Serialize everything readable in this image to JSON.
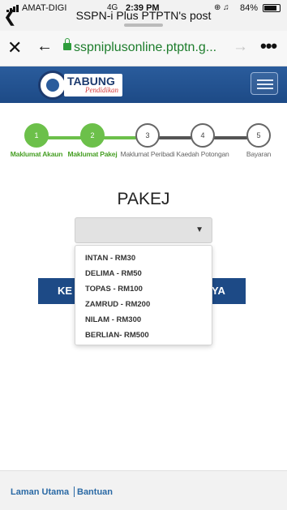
{
  "status_bar": {
    "carrier": "AMAT-DIGI",
    "network": "4G",
    "time": "2:39 PM",
    "battery": "84%"
  },
  "app_header": {
    "back_icon": "chevron-left-icon",
    "title": "SSPN-i Plus PTPTN's post"
  },
  "browser": {
    "url": "sspniplusonline.ptptn.g...",
    "secure_color": "#2e9d3c"
  },
  "site": {
    "logo_title": "TABUNG",
    "logo_subtitle": "Pendidikan",
    "banner_color": "#1d4a86"
  },
  "steps": [
    {
      "number": "1",
      "label": "Maklumat Akaun",
      "state": "done"
    },
    {
      "number": "2",
      "label": "Maklumat Pakej",
      "state": "done"
    },
    {
      "number": "3",
      "label": "Maklumat Peribadi",
      "state": "todo"
    },
    {
      "number": "4",
      "label": "Kaedah Potongan",
      "state": "todo"
    },
    {
      "number": "5",
      "label": "Bayaran",
      "state": "todo"
    }
  ],
  "page": {
    "heading": "PAKEJ",
    "select_value": "",
    "options": [
      "INTAN - RM30",
      "DELIMA - RM50",
      "TOPAS - RM100",
      "ZAMRUD - RM200",
      "NILAM - RM300",
      "BERLIAN- RM500"
    ],
    "button_left_fragment": "KE",
    "button_right_fragment": "YA"
  },
  "footer": {
    "home": "Laman Utama",
    "help": "Bantuan"
  },
  "colors": {
    "step_done": "#6cc04a",
    "step_label_done": "#49a027",
    "link": "#2b6aa5"
  }
}
